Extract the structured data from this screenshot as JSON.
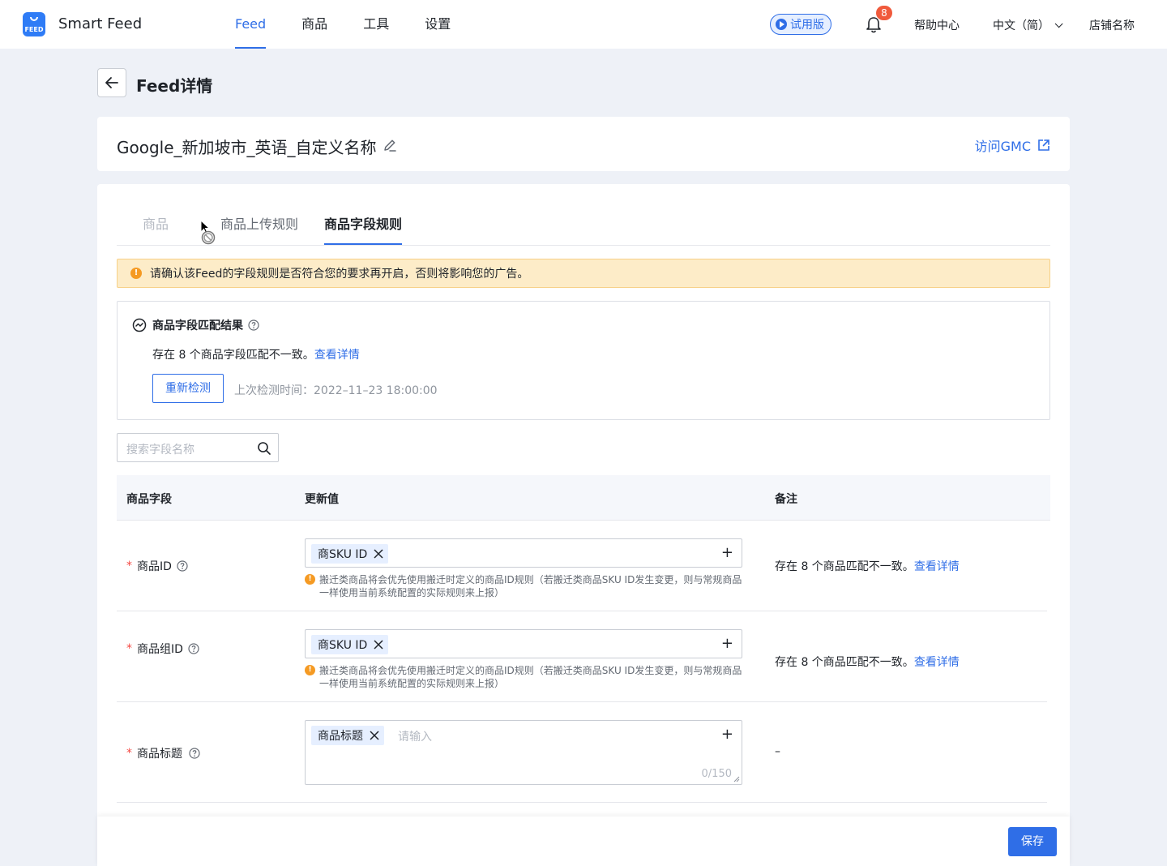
{
  "app": {
    "name": "Smart Feed",
    "logo_text": "FEED"
  },
  "nav": {
    "items": [
      {
        "label": "Feed"
      },
      {
        "label": "商品"
      },
      {
        "label": "工具"
      },
      {
        "label": "设置"
      }
    ],
    "active": "Feed"
  },
  "header_right": {
    "trial_label": "试用版",
    "notification_count": "8",
    "help_label": "帮助中心",
    "language_label": "中文（简）",
    "shop_label": "店铺名称"
  },
  "page": {
    "title": "Feed详情"
  },
  "feed": {
    "name": "Google_新加坡市_英语_自定义名称",
    "gmc_link": "访问GMC"
  },
  "tabs": [
    {
      "label": "商品",
      "state": "disabled"
    },
    {
      "label": "商品上传规则",
      "state": "normal"
    },
    {
      "label": "商品字段规则",
      "state": "active"
    }
  ],
  "alert": {
    "text": "请确认该Feed的字段规则是否符合您的要求再开启，否则将影响您的广告。"
  },
  "match": {
    "title": "商品字段匹配结果",
    "desc_prefix": "存在 8 个商品字段匹配不一致。",
    "desc_link": "查看详情",
    "recheck_label": "重新检测",
    "last_check": "上次检测时间：2022–11–23 18:00:00"
  },
  "search": {
    "placeholder": "搜索字段名称"
  },
  "table": {
    "columns": [
      "商品字段",
      "更新值",
      "备注"
    ],
    "rows": [
      {
        "field": "商品ID",
        "tag": "商SKU ID",
        "hint": "搬迁类商品将会优先使用搬迁时定义的商品ID规则（若搬迁类商品SKU ID发生变更，则与常规商品一样使用当前系统配置的实际规则来上报）",
        "note_prefix": "存在 8 个商品匹配不一致。",
        "note_link": "查看详情"
      },
      {
        "field": "商品组ID",
        "tag": "商SKU ID",
        "hint": "搬迁类商品将会优先使用搬迁时定义的商品ID规则（若搬迁类商品SKU ID发生变更，则与常规商品一样使用当前系统配置的实际规则来上报）",
        "note_prefix": "存在 8 个商品匹配不一致。",
        "note_link": "查看详情"
      },
      {
        "field": "商品标题",
        "tag": "商品标题",
        "placeholder": "请输入",
        "counter": "0/150",
        "note": "–"
      }
    ]
  },
  "footer": {
    "save_label": "保存"
  },
  "colors": {
    "primary": "#2f6ee7",
    "warning": "#f59a23",
    "alert_bg": "#fdecc8",
    "required": "#f54a45",
    "badge": "#f05a3c"
  }
}
